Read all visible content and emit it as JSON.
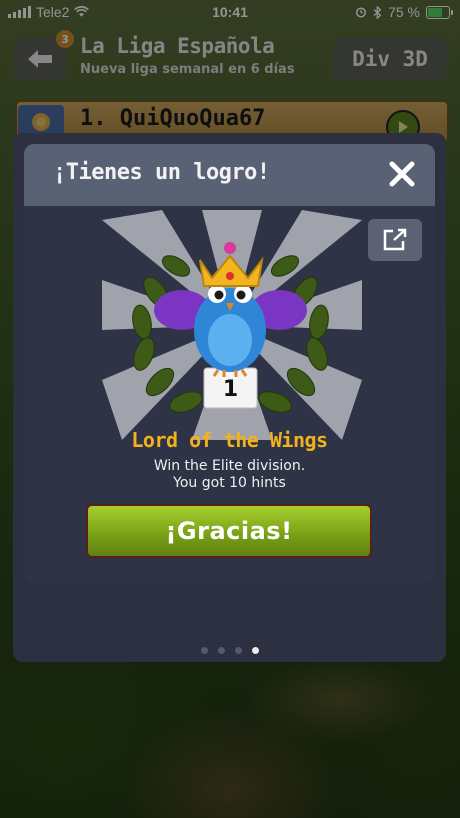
{
  "status_bar": {
    "carrier": "Tele2",
    "time": "10:41",
    "battery": "75 %",
    "battery_level": 0.75
  },
  "header": {
    "back_badge": "3",
    "league_title": "La Liga Española",
    "league_subtitle": "Nueva liga semanal en 6 días",
    "division_label": "Div 3D"
  },
  "ranking": {
    "entry": "1. QuiQuoQua67"
  },
  "achievement_popup": {
    "title": "¡Tienes un logro!",
    "achievement_name": "Lord of the Wings",
    "description_line1": "Win the Elite division.",
    "description_line2": "You got 10 hints",
    "rank_number": "1",
    "confirm_button": "¡Gracias!"
  },
  "pager": {
    "total_pages": 4,
    "current_page": 4
  },
  "colors": {
    "accent_gold": "#f3b11e",
    "button_green": "#8cb823",
    "card_bg": "#2e3346",
    "card_header": "#596274"
  },
  "icons": {
    "back": "arrow-left-icon",
    "close": "close-x-icon",
    "share": "share-external-icon",
    "play": "play-icon"
  }
}
